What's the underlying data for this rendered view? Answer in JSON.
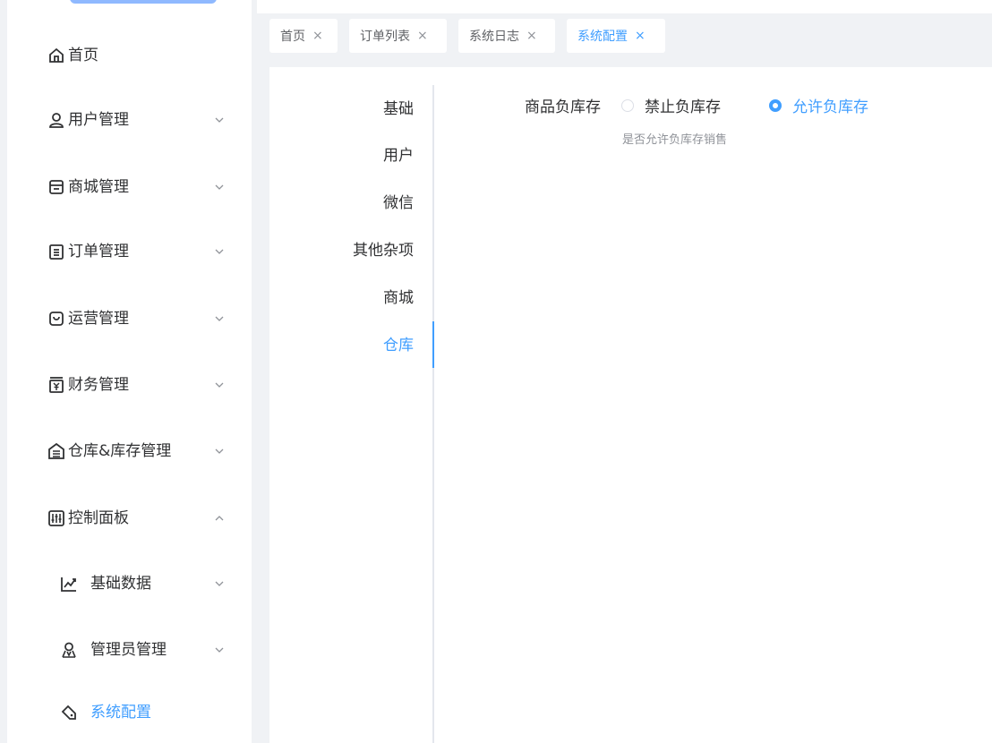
{
  "sidebar": {
    "items": [
      {
        "label": "首页",
        "icon": "home-icon"
      },
      {
        "label": "用户管理",
        "icon": "user-icon"
      },
      {
        "label": "商城管理",
        "icon": "shop-icon"
      },
      {
        "label": "订单管理",
        "icon": "order-icon"
      },
      {
        "label": "运营管理",
        "icon": "bag-icon"
      },
      {
        "label": "财务管理",
        "icon": "finance-icon"
      },
      {
        "label": "仓库&库存管理",
        "icon": "warehouse-icon"
      },
      {
        "label": "控制面板",
        "icon": "control-panel-icon"
      },
      {
        "label": "基础数据",
        "icon": "chart-icon"
      },
      {
        "label": "管理员管理",
        "icon": "admin-icon"
      },
      {
        "label": "系统配置",
        "icon": "tag-icon"
      }
    ]
  },
  "tabs": [
    {
      "label": "首页",
      "close": "×"
    },
    {
      "label": "订单列表",
      "close": "×"
    },
    {
      "label": "系统日志",
      "close": "×"
    },
    {
      "label": "系统配置",
      "close": "×"
    }
  ],
  "settings": {
    "vtabs": [
      "基础",
      "用户",
      "微信",
      "其他杂项",
      "商城",
      "仓库"
    ],
    "active_vtab": "仓库",
    "form": {
      "label": "商品负库存",
      "options": [
        "禁止负库存",
        "允许负库存"
      ],
      "selected": "允许负库存",
      "hint": "是否允许负库存销售"
    }
  },
  "colors": {
    "accent": "#409eff",
    "text": "#303133",
    "muted": "#909399",
    "background": "#f0f2f5"
  }
}
